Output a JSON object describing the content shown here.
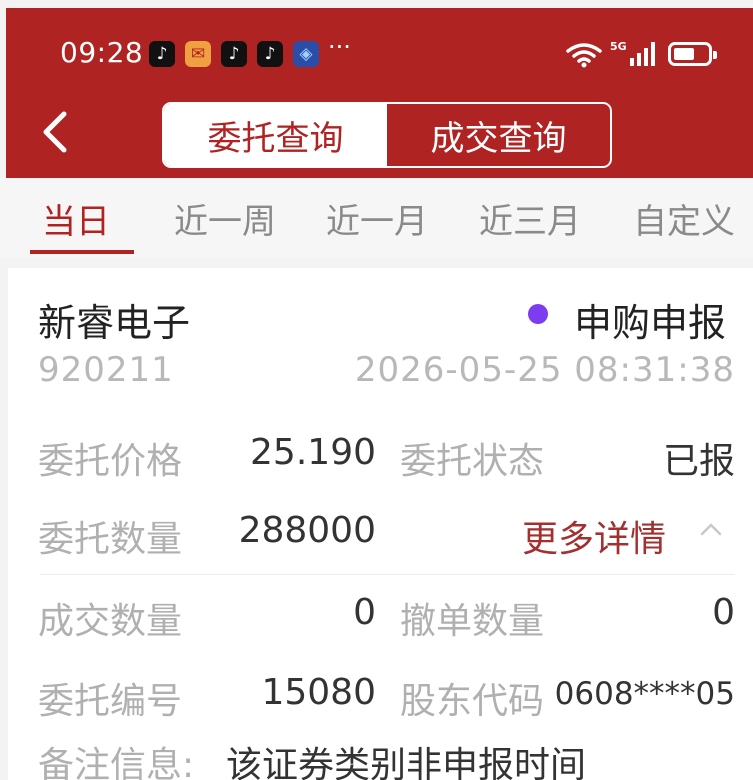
{
  "status_bar": {
    "time": "09:28",
    "app_icons": [
      "tiktok-icon",
      "envelope-icon",
      "tiktok-icon",
      "tiktok-icon",
      "game-icon"
    ],
    "more": "···",
    "network": "5G"
  },
  "header": {
    "tabs": [
      {
        "label": "委托查询",
        "active": true
      },
      {
        "label": "成交查询",
        "active": false
      }
    ]
  },
  "periods": [
    {
      "label": "当日",
      "active": true
    },
    {
      "label": "近一周",
      "active": false
    },
    {
      "label": "近一月",
      "active": false
    },
    {
      "label": "近三月",
      "active": false
    },
    {
      "label": "自定义",
      "active": false
    }
  ],
  "order": {
    "name": "新睿电子",
    "status": "申购申报",
    "code": "920211",
    "datetime": "2026-05-25 08:31:38",
    "price_label": "委托价格",
    "price": "25.190",
    "state_label": "委托状态",
    "state": "已报",
    "qty_label": "委托数量",
    "qty": "288000",
    "more_label": "更多详情",
    "deal_qty_label": "成交数量",
    "deal_qty": "0",
    "cancel_qty_label": "撤单数量",
    "cancel_qty": "0",
    "order_no_label": "委托编号",
    "order_no": "15080",
    "holder_label": "股东代码",
    "holder": "0608****05",
    "note_label": "备注信息:",
    "note": "该证券类别非申报时间"
  },
  "colors": {
    "brand": "#b02323",
    "status_dot": "#7d3cf0",
    "link": "#a33030"
  }
}
